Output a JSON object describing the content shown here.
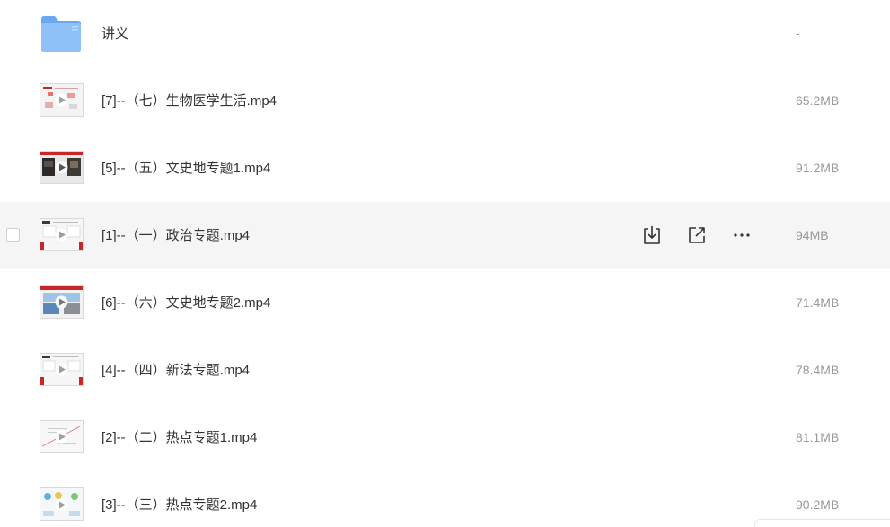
{
  "files": [
    {
      "type": "folder",
      "icon": "folder-icon",
      "name": "讲义",
      "size": "-"
    },
    {
      "type": "video",
      "icon": "video-thumbnail",
      "name": "[7]--（七）生物医学生活.mp4",
      "size": "65.2MB"
    },
    {
      "type": "video",
      "icon": "video-thumbnail",
      "name": "[5]--（五）文史地专题1.mp4",
      "size": "91.2MB"
    },
    {
      "type": "video",
      "icon": "video-thumbnail",
      "name": "[1]--（一）政治专题.mp4",
      "size": "94MB",
      "hovered": true
    },
    {
      "type": "video",
      "icon": "video-thumbnail",
      "name": "[6]--（六）文史地专题2.mp4",
      "size": "71.4MB"
    },
    {
      "type": "video",
      "icon": "video-thumbnail",
      "name": "[4]--（四）新法专题.mp4",
      "size": "78.4MB"
    },
    {
      "type": "video",
      "icon": "video-thumbnail",
      "name": "[2]--（二）热点专题1.mp4",
      "size": "81.1MB"
    },
    {
      "type": "video",
      "icon": "video-thumbnail",
      "name": "[3]--（三）热点专题2.mp4",
      "size": "90.2MB"
    }
  ],
  "row_actions": [
    {
      "icon": "download-icon"
    },
    {
      "icon": "share-icon"
    },
    {
      "icon": "more-icon"
    }
  ],
  "colors": {
    "hover_row": "#f5f5f5",
    "text": "#333333",
    "size_text": "#999999",
    "folder": "#7cb4f5",
    "thumb_accent": "#c62828"
  }
}
